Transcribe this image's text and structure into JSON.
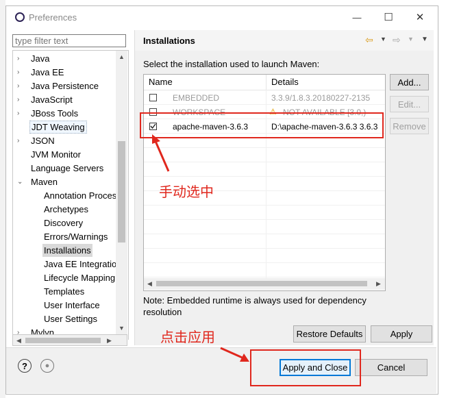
{
  "window": {
    "title": "Preferences",
    "min_symbol": "—",
    "max_symbol": "☐",
    "close_symbol": "✕"
  },
  "filter": {
    "placeholder": "type filter text"
  },
  "tree": {
    "items": [
      {
        "label": "Java",
        "arrow": "›"
      },
      {
        "label": "Java EE",
        "arrow": "›"
      },
      {
        "label": "Java Persistence",
        "arrow": "›"
      },
      {
        "label": "JavaScript",
        "arrow": "›"
      },
      {
        "label": "JBoss Tools",
        "arrow": "›"
      },
      {
        "label": "JDT Weaving",
        "arrow": ""
      },
      {
        "label": "JSON",
        "arrow": "›"
      },
      {
        "label": "JVM Monitor",
        "arrow": ""
      },
      {
        "label": "Language Servers",
        "arrow": ""
      },
      {
        "label": "Maven",
        "arrow": "⌄"
      },
      {
        "label": "Annotation Proces",
        "arrow": ""
      },
      {
        "label": "Archetypes",
        "arrow": ""
      },
      {
        "label": "Discovery",
        "arrow": ""
      },
      {
        "label": "Errors/Warnings",
        "arrow": ""
      },
      {
        "label": "Installations",
        "arrow": ""
      },
      {
        "label": "Java EE Integratio",
        "arrow": ""
      },
      {
        "label": "Lifecycle Mapping",
        "arrow": ""
      },
      {
        "label": "Templates",
        "arrow": ""
      },
      {
        "label": "User Interface",
        "arrow": ""
      },
      {
        "label": "User Settings",
        "arrow": ""
      },
      {
        "label": "Mylyn",
        "arrow": "›"
      }
    ]
  },
  "page": {
    "title": "Installations",
    "description": "Select the installation used to launch Maven:",
    "table": {
      "col_name": "Name",
      "col_details": "Details",
      "rows": [
        {
          "name": "EMBEDDED",
          "details": "3.3.9/1.8.3.20180227-2135",
          "checked": false,
          "disabled": true
        },
        {
          "name": "WORKSPACE",
          "details": "NOT AVAILABLE [3.0,)",
          "checked": false,
          "disabled": true
        },
        {
          "name": "apache-maven-3.6.3",
          "details": "D:\\apache-maven-3.6.3 3.6.3",
          "checked": true,
          "disabled": false
        }
      ]
    },
    "buttons": {
      "add": "Add...",
      "edit": "Edit...",
      "remove": "Remove"
    },
    "note": "Note: Embedded runtime is always used for dependency resolution",
    "restore_defaults": "Restore Defaults",
    "apply": "Apply"
  },
  "footer": {
    "apply_close": "Apply and Close",
    "cancel": "Cancel",
    "help_icon": "?",
    "record_icon": "●"
  },
  "annotations": {
    "manual_select": "手动选中",
    "click_apply": "点击应用"
  },
  "colors": {
    "annotation_red": "#e0271d",
    "selection_bg": "#cde8ff"
  }
}
